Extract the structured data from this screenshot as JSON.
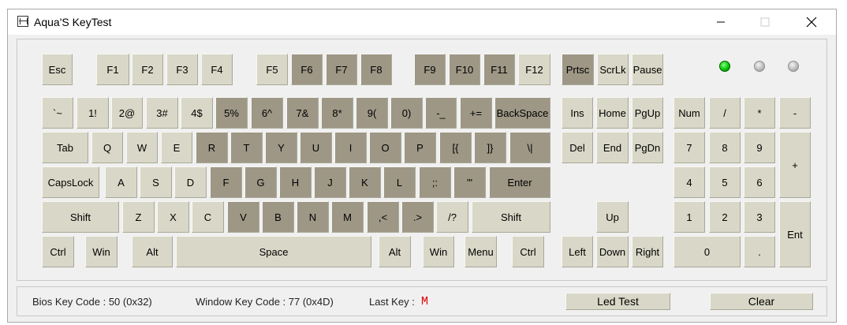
{
  "window": {
    "title": "Aqua'S KeyTest"
  },
  "leds": [
    {
      "name": "num-lock-led",
      "on": true
    },
    {
      "name": "caps-lock-led",
      "on": false
    },
    {
      "name": "scroll-lock-led",
      "on": false
    }
  ],
  "colors": {
    "key_idle": "#d9d8c8",
    "key_tested": "#9e9786",
    "led_on": "#00c000",
    "led_off": "#b8b8b8",
    "last_key": "#e00000"
  },
  "keys": [
    {
      "id": "esc",
      "label": "Esc",
      "pressed": false
    },
    {
      "id": "f1",
      "label": "F1",
      "pressed": false
    },
    {
      "id": "f2",
      "label": "F2",
      "pressed": false
    },
    {
      "id": "f3",
      "label": "F3",
      "pressed": false
    },
    {
      "id": "f4",
      "label": "F4",
      "pressed": false
    },
    {
      "id": "f5",
      "label": "F5",
      "pressed": false
    },
    {
      "id": "f6",
      "label": "F6",
      "pressed": true
    },
    {
      "id": "f7",
      "label": "F7",
      "pressed": true
    },
    {
      "id": "f8",
      "label": "F8",
      "pressed": true
    },
    {
      "id": "f9",
      "label": "F9",
      "pressed": true
    },
    {
      "id": "f10",
      "label": "F10",
      "pressed": true
    },
    {
      "id": "f11",
      "label": "F11",
      "pressed": true
    },
    {
      "id": "f12",
      "label": "F12",
      "pressed": false
    },
    {
      "id": "prtsc",
      "label": "Prtsc",
      "pressed": true
    },
    {
      "id": "scrlk",
      "label": "ScrLk",
      "pressed": false
    },
    {
      "id": "pause",
      "label": "Pause",
      "pressed": false
    },
    {
      "id": "backtick",
      "label": "`~",
      "pressed": false
    },
    {
      "id": "digit1",
      "label": "1!",
      "pressed": false
    },
    {
      "id": "digit2",
      "label": "2@",
      "pressed": false
    },
    {
      "id": "digit3",
      "label": "3#",
      "pressed": false
    },
    {
      "id": "digit4",
      "label": "4$",
      "pressed": false
    },
    {
      "id": "digit5",
      "label": "5%",
      "pressed": true
    },
    {
      "id": "digit6",
      "label": "6^",
      "pressed": true
    },
    {
      "id": "digit7",
      "label": "7&",
      "pressed": true
    },
    {
      "id": "digit8",
      "label": "8*",
      "pressed": true
    },
    {
      "id": "digit9",
      "label": "9(",
      "pressed": true
    },
    {
      "id": "digit0",
      "label": "0)",
      "pressed": true
    },
    {
      "id": "minus",
      "label": "-_",
      "pressed": true
    },
    {
      "id": "equal",
      "label": "+=",
      "pressed": true
    },
    {
      "id": "backspace",
      "label": "BackSpace",
      "pressed": true
    },
    {
      "id": "ins",
      "label": "Ins",
      "pressed": false
    },
    {
      "id": "home",
      "label": "Home",
      "pressed": false
    },
    {
      "id": "pgup",
      "label": "PgUp",
      "pressed": false
    },
    {
      "id": "num",
      "label": "Num",
      "pressed": false
    },
    {
      "id": "np-slash",
      "label": "/",
      "pressed": false
    },
    {
      "id": "np-star",
      "label": "*",
      "pressed": false
    },
    {
      "id": "np-minus",
      "label": "-",
      "pressed": false
    },
    {
      "id": "tab",
      "label": "Tab",
      "pressed": false
    },
    {
      "id": "q",
      "label": "Q",
      "pressed": false
    },
    {
      "id": "w",
      "label": "W",
      "pressed": false
    },
    {
      "id": "e",
      "label": "E",
      "pressed": false
    },
    {
      "id": "r",
      "label": "R",
      "pressed": true
    },
    {
      "id": "t",
      "label": "T",
      "pressed": true
    },
    {
      "id": "y",
      "label": "Y",
      "pressed": true
    },
    {
      "id": "u",
      "label": "U",
      "pressed": true
    },
    {
      "id": "i",
      "label": "I",
      "pressed": true
    },
    {
      "id": "o",
      "label": "O",
      "pressed": true
    },
    {
      "id": "p",
      "label": "P",
      "pressed": true
    },
    {
      "id": "lbracket",
      "label": "[{",
      "pressed": true
    },
    {
      "id": "rbracket",
      "label": "]}",
      "pressed": true
    },
    {
      "id": "backslash",
      "label": "\\|",
      "pressed": true
    },
    {
      "id": "del",
      "label": "Del",
      "pressed": false
    },
    {
      "id": "end",
      "label": "End",
      "pressed": false
    },
    {
      "id": "pgdn",
      "label": "PgDn",
      "pressed": false
    },
    {
      "id": "np7",
      "label": "7",
      "pressed": false
    },
    {
      "id": "np8",
      "label": "8",
      "pressed": false
    },
    {
      "id": "np9",
      "label": "9",
      "pressed": false
    },
    {
      "id": "np-plus",
      "label": "+",
      "pressed": false
    },
    {
      "id": "capslock",
      "label": "CapsLock",
      "pressed": false
    },
    {
      "id": "a",
      "label": "A",
      "pressed": false
    },
    {
      "id": "s",
      "label": "S",
      "pressed": false
    },
    {
      "id": "d",
      "label": "D",
      "pressed": false
    },
    {
      "id": "f",
      "label": "F",
      "pressed": true
    },
    {
      "id": "g",
      "label": "G",
      "pressed": true
    },
    {
      "id": "h",
      "label": "H",
      "pressed": true
    },
    {
      "id": "j",
      "label": "J",
      "pressed": true
    },
    {
      "id": "k",
      "label": "K",
      "pressed": true
    },
    {
      "id": "l",
      "label": "L",
      "pressed": true
    },
    {
      "id": "semicolon",
      "label": ";:",
      "pressed": true
    },
    {
      "id": "quote",
      "label": "'\"",
      "pressed": true
    },
    {
      "id": "enter",
      "label": "Enter",
      "pressed": true
    },
    {
      "id": "np4",
      "label": "4",
      "pressed": false
    },
    {
      "id": "np5",
      "label": "5",
      "pressed": false
    },
    {
      "id": "np6",
      "label": "6",
      "pressed": false
    },
    {
      "id": "lshift",
      "label": "Shift",
      "pressed": false
    },
    {
      "id": "z",
      "label": "Z",
      "pressed": false
    },
    {
      "id": "x",
      "label": "X",
      "pressed": false
    },
    {
      "id": "c",
      "label": "C",
      "pressed": false
    },
    {
      "id": "v",
      "label": "V",
      "pressed": true
    },
    {
      "id": "b",
      "label": "B",
      "pressed": true
    },
    {
      "id": "n",
      "label": "N",
      "pressed": true
    },
    {
      "id": "m",
      "label": "M",
      "pressed": true
    },
    {
      "id": "comma",
      "label": ",<",
      "pressed": true
    },
    {
      "id": "period",
      "label": ".>",
      "pressed": true
    },
    {
      "id": "slash",
      "label": "/?",
      "pressed": false
    },
    {
      "id": "rshift",
      "label": "Shift",
      "pressed": false
    },
    {
      "id": "up",
      "label": "Up",
      "pressed": false
    },
    {
      "id": "np1",
      "label": "1",
      "pressed": false
    },
    {
      "id": "np2",
      "label": "2",
      "pressed": false
    },
    {
      "id": "np3",
      "label": "3",
      "pressed": false
    },
    {
      "id": "np-enter",
      "label": "Ent",
      "pressed": false
    },
    {
      "id": "lctrl",
      "label": "Ctrl",
      "pressed": false
    },
    {
      "id": "lwin",
      "label": "Win",
      "pressed": false
    },
    {
      "id": "lalt",
      "label": "Alt",
      "pressed": false
    },
    {
      "id": "space",
      "label": "Space",
      "pressed": false
    },
    {
      "id": "ralt",
      "label": "Alt",
      "pressed": false
    },
    {
      "id": "rwin",
      "label": "Win",
      "pressed": false
    },
    {
      "id": "menu",
      "label": "Menu",
      "pressed": false
    },
    {
      "id": "rctrl",
      "label": "Ctrl",
      "pressed": false
    },
    {
      "id": "left",
      "label": "Left",
      "pressed": false
    },
    {
      "id": "down",
      "label": "Down",
      "pressed": false
    },
    {
      "id": "right",
      "label": "Right",
      "pressed": false
    },
    {
      "id": "np0",
      "label": "0",
      "pressed": false
    },
    {
      "id": "np-dot",
      "label": ".",
      "pressed": false
    }
  ],
  "status": {
    "bios_key_code": "Bios Key Code : 50 (0x32)",
    "window_key_code": "Window Key Code : 77 (0x4D)",
    "last_key_label": "Last Key :",
    "last_key_value": "M",
    "led_test_button": "Led Test",
    "clear_button": "Clear"
  }
}
